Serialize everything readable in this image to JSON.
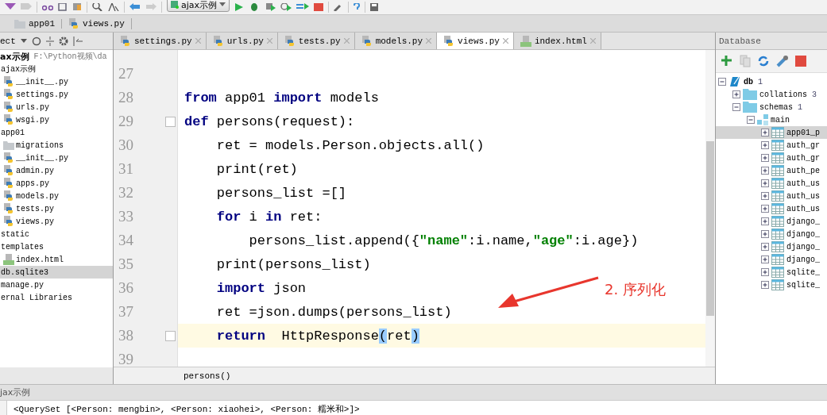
{
  "toolbar": {
    "run_config": "ajax示例"
  },
  "breadcrumb": [
    {
      "kind": "folder",
      "label": "app01"
    },
    {
      "kind": "py",
      "label": "views.py"
    }
  ],
  "project": {
    "header": "ect",
    "root": {
      "label": "ax示例",
      "path": "F:\\Python视频\\da"
    },
    "items": [
      {
        "label": "ajax示例",
        "selected": false,
        "children": [
          {
            "kind": "py",
            "label": "__init__.py",
            "selected": false
          },
          {
            "kind": "py",
            "label": "settings.py",
            "selected": false
          },
          {
            "kind": "py",
            "label": "urls.py",
            "selected": false
          },
          {
            "kind": "py",
            "label": "wsgi.py",
            "selected": false
          }
        ]
      },
      {
        "label": "app01",
        "selected": false,
        "children": [
          {
            "kind": "folder",
            "label": "migrations",
            "selected": false
          },
          {
            "kind": "py",
            "label": "__init__.py",
            "selected": false
          },
          {
            "kind": "py",
            "label": "admin.py",
            "selected": false
          },
          {
            "kind": "py",
            "label": "apps.py",
            "selected": false
          },
          {
            "kind": "py",
            "label": "models.py",
            "selected": false
          },
          {
            "kind": "py",
            "label": "tests.py",
            "selected": false
          },
          {
            "kind": "py",
            "label": "views.py",
            "selected": false
          }
        ]
      },
      {
        "label": "static",
        "selected": false
      },
      {
        "label": "templates",
        "selected": false,
        "children": [
          {
            "kind": "html",
            "label": "index.html",
            "selected": false
          }
        ]
      },
      {
        "label": "db.sqlite3",
        "selected": true
      },
      {
        "label": "manage.py",
        "selected": false
      },
      {
        "label": "ernal Libraries",
        "selected": false
      }
    ]
  },
  "tabs": [
    {
      "kind": "py",
      "label": "settings.py",
      "selected": false
    },
    {
      "kind": "py",
      "label": "urls.py",
      "selected": false
    },
    {
      "kind": "py",
      "label": "tests.py",
      "selected": false
    },
    {
      "kind": "py",
      "label": "models.py",
      "selected": false
    },
    {
      "kind": "py",
      "label": "views.py",
      "selected": true
    },
    {
      "kind": "html",
      "label": "index.html",
      "selected": false
    }
  ],
  "code": [
    {
      "n": "27",
      "current": false,
      "fold": false
    },
    {
      "n": "28",
      "current": false,
      "fold": false,
      "tokens": [
        {
          "kind": "kw",
          "text": "from"
        },
        {
          "kind": "plain",
          "text": " app01 "
        },
        {
          "kind": "kw",
          "text": "import"
        },
        {
          "kind": "plain",
          "text": " models"
        }
      ]
    },
    {
      "n": "29",
      "current": false,
      "fold": true,
      "tokens": [
        {
          "kind": "kw",
          "text": "def"
        },
        {
          "kind": "plain",
          "text": " persons(request):"
        }
      ]
    },
    {
      "n": "30",
      "current": false,
      "fold": false,
      "tokens": [
        {
          "kind": "plain",
          "text": "    ret = models.Person.objects.all()"
        }
      ]
    },
    {
      "n": "31",
      "current": false,
      "fold": false,
      "tokens": [
        {
          "kind": "plain",
          "text": "    print(ret)"
        }
      ]
    },
    {
      "n": "32",
      "current": false,
      "fold": false,
      "tokens": [
        {
          "kind": "plain",
          "text": "    persons_list =[]"
        }
      ]
    },
    {
      "n": "33",
      "current": false,
      "fold": false,
      "tokens": [
        {
          "kind": "kw",
          "text": "    for"
        },
        {
          "kind": "plain",
          "text": " i "
        },
        {
          "kind": "kw",
          "text": "in"
        },
        {
          "kind": "plain",
          "text": " ret:"
        }
      ]
    },
    {
      "n": "34",
      "current": false,
      "fold": false,
      "tokens": [
        {
          "kind": "plain",
          "text": "        persons_list.append({"
        },
        {
          "kind": "str",
          "text": "\"name\""
        },
        {
          "kind": "plain",
          "text": ":i.name,"
        },
        {
          "kind": "str",
          "text": "\"age\""
        },
        {
          "kind": "plain",
          "text": ":i.age})"
        }
      ]
    },
    {
      "n": "35",
      "current": false,
      "fold": false,
      "tokens": [
        {
          "kind": "plain",
          "text": "    print(persons_list)"
        }
      ]
    },
    {
      "n": "36",
      "current": false,
      "fold": false,
      "tokens": [
        {
          "kind": "kw",
          "text": "    import"
        },
        {
          "kind": "plain",
          "text": " json"
        }
      ]
    },
    {
      "n": "37",
      "current": false,
      "fold": false,
      "tokens": [
        {
          "kind": "plain",
          "text": "    ret =json.dumps(persons_list)"
        }
      ]
    },
    {
      "n": "38",
      "current": true,
      "fold": true,
      "tokens": [
        {
          "kind": "kw",
          "text": "    return"
        },
        {
          "kind": "plain",
          "text": "  HttpResponse"
        },
        {
          "kind": "match",
          "text": "("
        },
        {
          "kind": "plain",
          "text": "ret"
        },
        {
          "kind": "match",
          "text": ")"
        }
      ]
    },
    {
      "n": "39",
      "current": false,
      "fold": false
    }
  ],
  "annotation": "2. 序列化",
  "editor_breadcrumb": "persons()",
  "database": {
    "header": "Database",
    "tree": [
      {
        "kind": "db",
        "label": "db",
        "count": "1",
        "expanded": true,
        "selected": false,
        "children": [
          {
            "kind": "folder",
            "label": "collations",
            "count": "3",
            "expanded": false,
            "selected": false
          },
          {
            "kind": "folder",
            "label": "schemas",
            "count": "1",
            "expanded": true,
            "selected": false,
            "children": [
              {
                "kind": "schema",
                "label": "main",
                "expanded": true,
                "selected": false,
                "children": [
                  {
                    "kind": "table",
                    "label": "app01_p",
                    "expanded": false,
                    "selected": true
                  },
                  {
                    "kind": "table",
                    "label": "auth_gr",
                    "expanded": false,
                    "selected": false
                  },
                  {
                    "kind": "table",
                    "label": "auth_gr",
                    "expanded": false,
                    "selected": false
                  },
                  {
                    "kind": "table",
                    "label": "auth_pe",
                    "expanded": false,
                    "selected": false
                  },
                  {
                    "kind": "table",
                    "label": "auth_us",
                    "expanded": false,
                    "selected": false
                  },
                  {
                    "kind": "table",
                    "label": "auth_us",
                    "expanded": false,
                    "selected": false
                  },
                  {
                    "kind": "table",
                    "label": "auth_us",
                    "expanded": false,
                    "selected": false
                  },
                  {
                    "kind": "table",
                    "label": "django_",
                    "expanded": false,
                    "selected": false
                  },
                  {
                    "kind": "table",
                    "label": "django_",
                    "expanded": false,
                    "selected": false
                  },
                  {
                    "kind": "table",
                    "label": "django_",
                    "expanded": false,
                    "selected": false
                  },
                  {
                    "kind": "table",
                    "label": "django_",
                    "expanded": false,
                    "selected": false
                  },
                  {
                    "kind": "table",
                    "label": "sqlite_",
                    "expanded": false,
                    "selected": false
                  },
                  {
                    "kind": "table",
                    "label": "sqlite_",
                    "expanded": false,
                    "selected": false
                  }
                ]
              }
            ]
          }
        ]
      }
    ]
  },
  "run": {
    "title": "jax示例",
    "output": "<QuerySet [<Person: mengbin>, <Person: xiaohei>, <Person: 糯米和>]>"
  }
}
